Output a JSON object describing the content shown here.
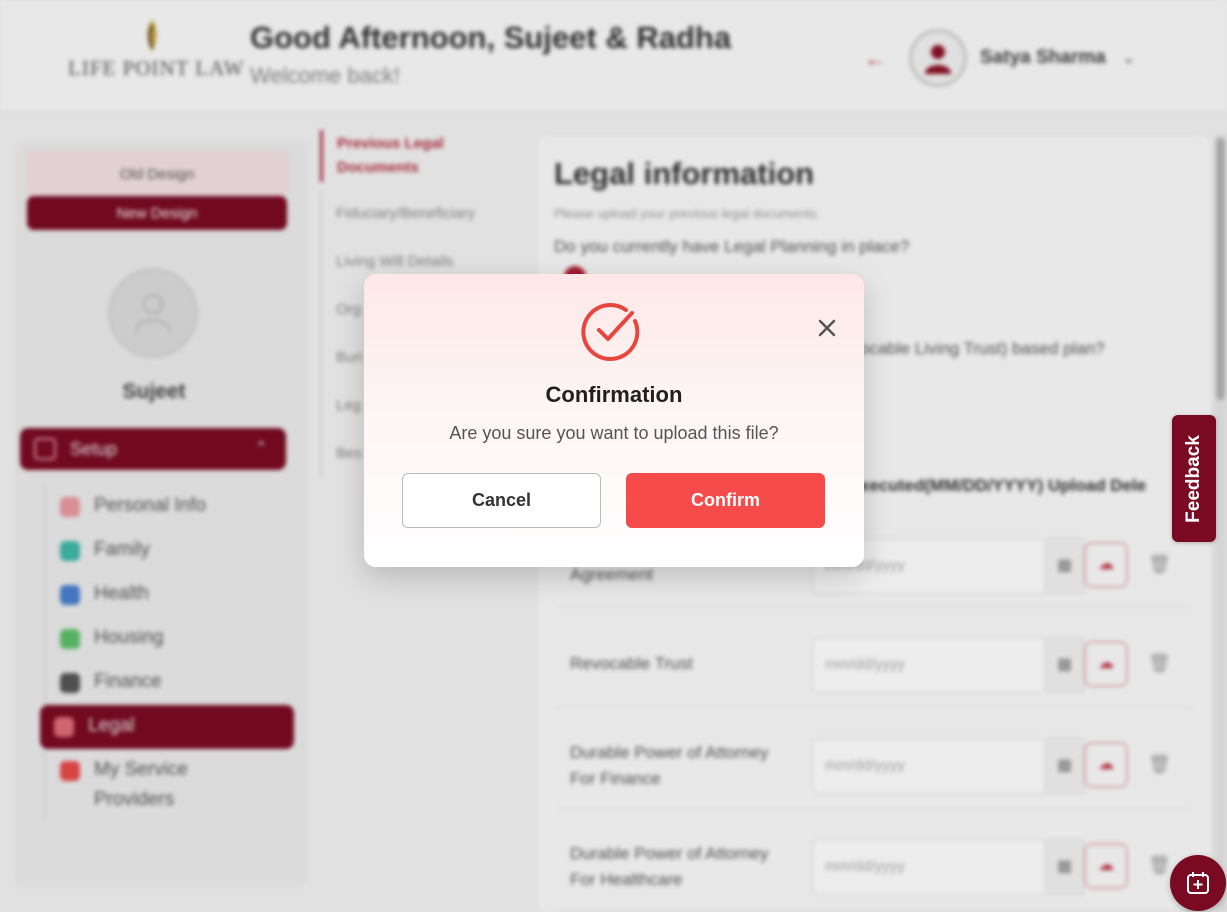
{
  "header": {
    "logo_text": "LIFE POINT LAW",
    "greeting": "Good Afternoon, Sujeet & Radha",
    "welcome": "Welcome back!",
    "user_name": "Satya Sharma"
  },
  "sidebar": {
    "old_design": "Old Design",
    "new_design": "New Design",
    "profile_name": "Sujeet",
    "setup_label": "Setup",
    "items": [
      {
        "label": "Personal Info",
        "color": "#e89aa0"
      },
      {
        "label": "Family",
        "color": "#3fb8a8"
      },
      {
        "label": "Health",
        "color": "#4a7fd0"
      },
      {
        "label": "Housing",
        "color": "#5fbf6a"
      },
      {
        "label": "Finance",
        "color": "#555555"
      },
      {
        "label": "Legal",
        "color": "#e06d7a"
      },
      {
        "label": "My Service Providers",
        "color": "#e84a4a"
      }
    ]
  },
  "subnav": {
    "items": [
      "Previous Legal Documents",
      "Fiduciary/Beneficiary",
      "Living Will Details",
      "Org",
      "Buri",
      "Leg",
      "Bes"
    ]
  },
  "main": {
    "title": "Legal information",
    "hint": "Please upload your previous legal documents.",
    "question1": "Do you currently have Legal Planning in place?",
    "question2": "ocable Living Trust) based plan?",
    "column_header": "xecuted(MM/DD/YYYY) Upload Dele",
    "date_placeholder": "mm/dd/yyyy",
    "documents": [
      {
        "name": "Agreement"
      },
      {
        "name": "Revocable Trust"
      },
      {
        "name": "Durable Power of Attorney For Finance"
      },
      {
        "name": "Durable Power of Attorney For Healthcare"
      }
    ]
  },
  "feedback": {
    "label": "Feedback"
  },
  "modal": {
    "title": "Confirmation",
    "message": "Are you sure you want to upload this file?",
    "cancel_label": "Cancel",
    "confirm_label": "Confirm",
    "accent_color": "#f54b4b",
    "icon": "check-circle-icon"
  }
}
